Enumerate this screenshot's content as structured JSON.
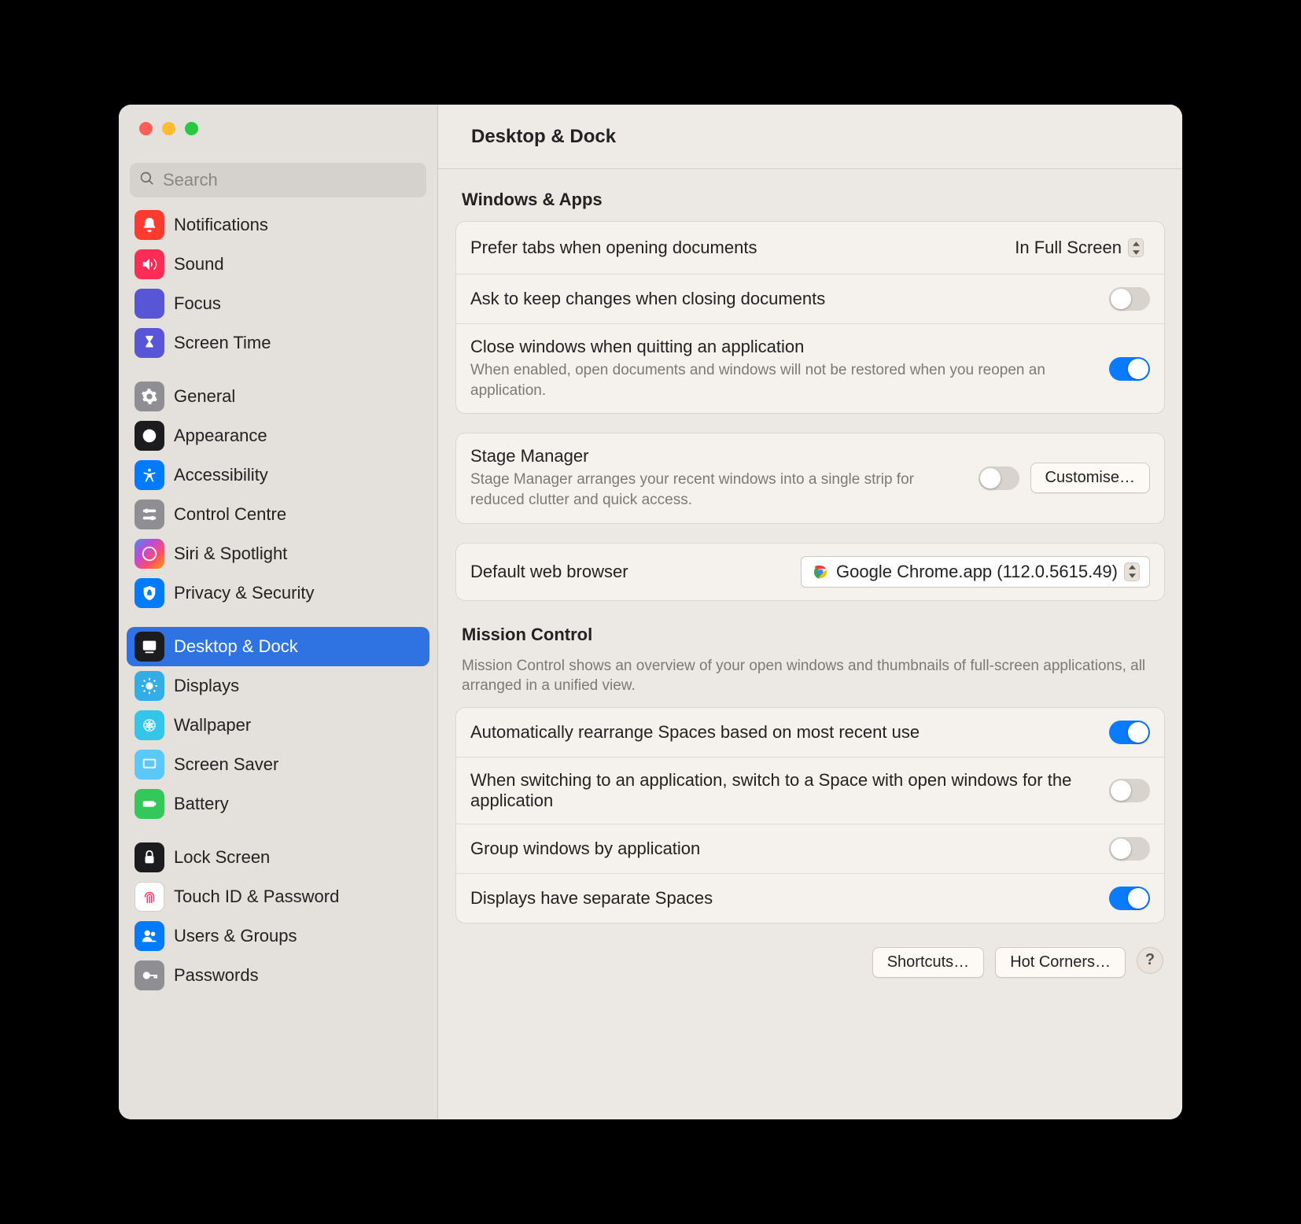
{
  "search": {
    "placeholder": "Search"
  },
  "sidebar": {
    "groups": [
      {
        "items": [
          {
            "key": "notifications",
            "label": "Notifications"
          },
          {
            "key": "sound",
            "label": "Sound"
          },
          {
            "key": "focus",
            "label": "Focus"
          },
          {
            "key": "screentime",
            "label": "Screen Time"
          }
        ]
      },
      {
        "items": [
          {
            "key": "general",
            "label": "General"
          },
          {
            "key": "appearance",
            "label": "Appearance"
          },
          {
            "key": "accessibility",
            "label": "Accessibility"
          },
          {
            "key": "controlcentre",
            "label": "Control Centre"
          },
          {
            "key": "siri",
            "label": "Siri & Spotlight"
          },
          {
            "key": "privacy",
            "label": "Privacy & Security"
          }
        ]
      },
      {
        "items": [
          {
            "key": "desktopdock",
            "label": "Desktop & Dock",
            "selected": true
          },
          {
            "key": "displays",
            "label": "Displays"
          },
          {
            "key": "wallpaper",
            "label": "Wallpaper"
          },
          {
            "key": "screensaver",
            "label": "Screen Saver"
          },
          {
            "key": "battery",
            "label": "Battery"
          }
        ]
      },
      {
        "items": [
          {
            "key": "lockscreen",
            "label": "Lock Screen"
          },
          {
            "key": "touchid",
            "label": "Touch ID & Password"
          },
          {
            "key": "users",
            "label": "Users & Groups"
          },
          {
            "key": "passwords",
            "label": "Passwords"
          }
        ]
      }
    ]
  },
  "header": {
    "title": "Desktop & Dock"
  },
  "sections": {
    "windows_apps": {
      "title": "Windows & Apps",
      "prefer_tabs": {
        "label": "Prefer tabs when opening documents",
        "value": "In Full Screen"
      },
      "ask_keep": {
        "label": "Ask to keep changes when closing documents",
        "on": false
      },
      "close_windows": {
        "label": "Close windows when quitting an application",
        "desc": "When enabled, open documents and windows will not be restored when you reopen an application.",
        "on": true
      },
      "stage_manager": {
        "label": "Stage Manager",
        "desc": "Stage Manager arranges your recent windows into a single strip for reduced clutter and quick access.",
        "on": false,
        "customise": "Customise…"
      },
      "default_browser": {
        "label": "Default web browser",
        "value": "Google Chrome.app (112.0.5615.49)"
      }
    },
    "mission_control": {
      "title": "Mission Control",
      "desc": "Mission Control shows an overview of your open windows and thumbnails of full-screen applications, all arranged in a unified view.",
      "auto_rearrange": {
        "label": "Automatically rearrange Spaces based on most recent use",
        "on": true
      },
      "switch_space": {
        "label": "When switching to an application, switch to a Space with open windows for the application",
        "on": false
      },
      "group_windows": {
        "label": "Group windows by application",
        "on": false
      },
      "separate_spaces": {
        "label": "Displays have separate Spaces",
        "on": true
      }
    }
  },
  "footer": {
    "shortcuts": "Shortcuts…",
    "hot_corners": "Hot Corners…",
    "help": "?"
  }
}
